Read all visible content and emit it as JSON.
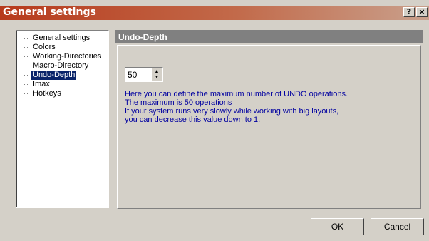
{
  "window": {
    "title": "General settings",
    "help_glyph": "?",
    "close_glyph": "×"
  },
  "tree": {
    "items": [
      {
        "label": "General settings",
        "selected": false
      },
      {
        "label": "Colors",
        "selected": false
      },
      {
        "label": "Working-Directories",
        "selected": false
      },
      {
        "label": "Macro-Directory",
        "selected": false
      },
      {
        "label": "Undo-Depth",
        "selected": true
      },
      {
        "label": "Imax",
        "selected": false
      },
      {
        "label": "Hotkeys",
        "selected": false
      }
    ]
  },
  "panel": {
    "header": "Undo-Depth",
    "spin_value": "50",
    "description": [
      "Here you can define the maximum number of UNDO operations.",
      "The maximum is 50 operations",
      "If your system runs very slowly while working with big layouts,",
      "you can decrease this value down to 1."
    ]
  },
  "buttons": {
    "ok": "OK",
    "cancel": "Cancel"
  },
  "colors": {
    "title_start": "#b73a1c",
    "selection": "#0a246a",
    "description_text": "#0000a0"
  }
}
